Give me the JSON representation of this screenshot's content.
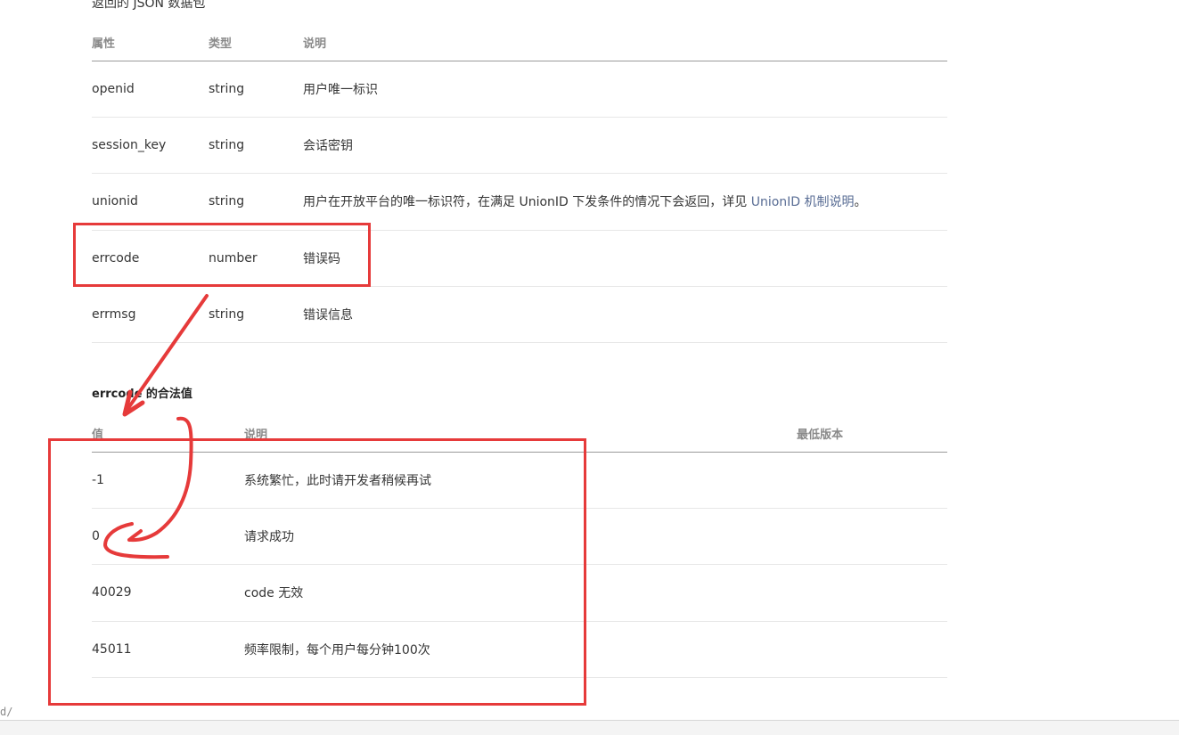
{
  "section_caption": "返回的 JSON 数据包",
  "props_table": {
    "headers": [
      "属性",
      "类型",
      "说明"
    ],
    "rows": [
      {
        "name": "openid",
        "type": "string",
        "desc": "用户唯一标识"
      },
      {
        "name": "session_key",
        "type": "string",
        "desc": "会话密钥"
      },
      {
        "name": "unionid",
        "type": "string",
        "desc": "用户在开放平台的唯一标识符，在满足 UnionID 下发条件的情况下会返回，详见 ",
        "link": "UnionID 机制说明",
        "desc_end": "。"
      },
      {
        "name": "errcode",
        "type": "number",
        "desc": "错误码"
      },
      {
        "name": "errmsg",
        "type": "string",
        "desc": "错误信息"
      }
    ]
  },
  "errcode_heading": "errcode 的合法值",
  "errcode_table": {
    "headers": [
      "值",
      "说明",
      "最低版本"
    ],
    "rows": [
      {
        "value": "-1",
        "desc": "系统繁忙，此时请开发者稍候再试",
        "min_version": ""
      },
      {
        "value": "0",
        "desc": "请求成功",
        "min_version": ""
      },
      {
        "value": "40029",
        "desc": "code 无效",
        "min_version": ""
      },
      {
        "value": "45011",
        "desc": "频率限制，每个用户每分钟100次",
        "min_version": ""
      }
    ]
  },
  "status_fragment": "d/",
  "annotation_color": "#e63a3a",
  "link_color": "#586c94"
}
